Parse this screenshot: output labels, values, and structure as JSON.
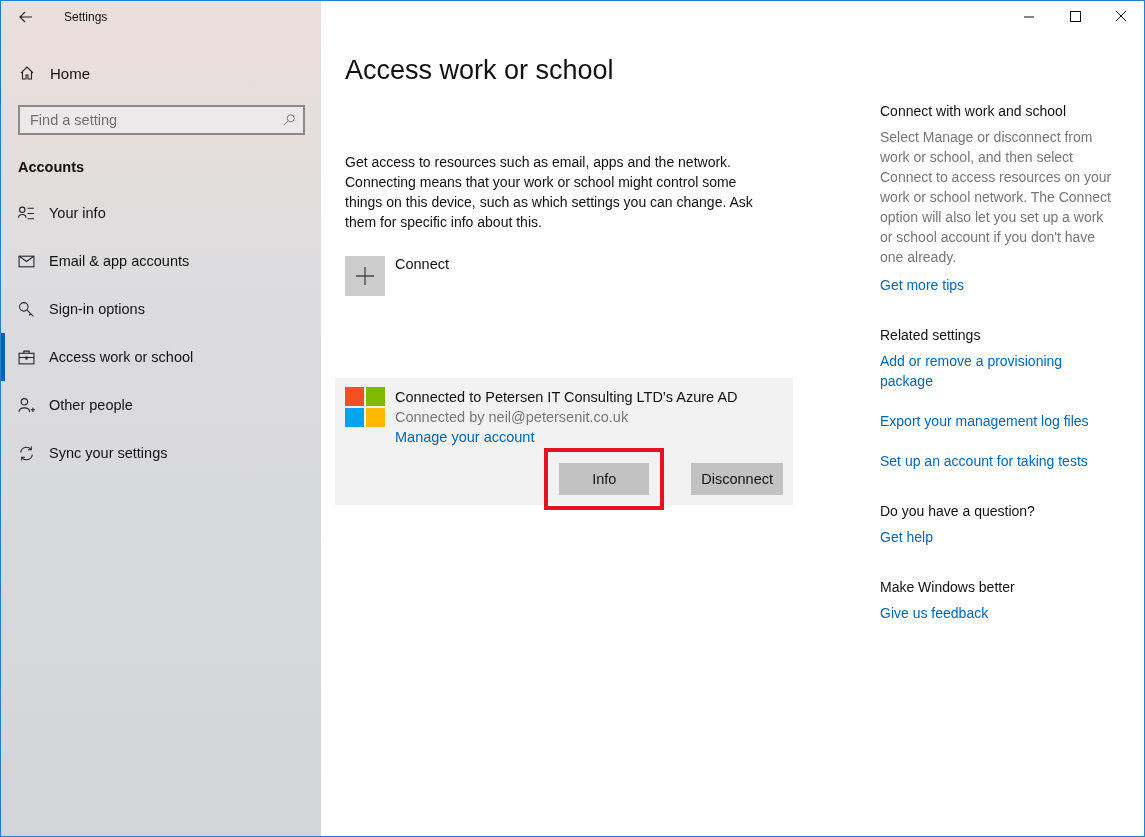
{
  "window": {
    "title": "Settings"
  },
  "sidebar": {
    "home": "Home",
    "search": {
      "placeholder": "Find a setting"
    },
    "section": "Accounts",
    "items": [
      {
        "label": "Your info",
        "selected": false
      },
      {
        "label": "Email & app accounts",
        "selected": false
      },
      {
        "label": "Sign-in options",
        "selected": false
      },
      {
        "label": "Access work or school",
        "selected": true
      },
      {
        "label": "Other people",
        "selected": false
      },
      {
        "label": "Sync your settings",
        "selected": false
      }
    ]
  },
  "page": {
    "title": "Access work or school",
    "description": "Get access to resources such as email, apps and the network. Connecting means that your work or school might control some things on this device, such as which settings you can change. Ask them for specific info about this.",
    "connect": "Connect",
    "account": {
      "title": "Connected to Petersen IT Consulting LTD’s Azure AD",
      "subtitle": "Connected by neil@petersenit.co.uk",
      "link": "Manage your account",
      "buttons": [
        {
          "label": "Info",
          "highlighted": true
        },
        {
          "label": "Disconnect",
          "highlighted": false
        }
      ]
    }
  },
  "aside": [
    {
      "heading": "Connect with work and school",
      "text": "Select Manage or disconnect from work or school, and then select Connect to access resources on your work or school network. The Connect option will also let you set up a work or school account if you don't have one already.",
      "links": [
        "Get more tips"
      ]
    },
    {
      "heading": "Related settings",
      "links": [
        "Add or remove a provisioning package",
        "Export your management log files",
        "Set up an account for taking tests"
      ]
    },
    {
      "heading": "Do you have a question?",
      "links": [
        "Get help"
      ]
    },
    {
      "heading": "Make Windows better",
      "links": [
        "Give us feedback"
      ]
    }
  ]
}
